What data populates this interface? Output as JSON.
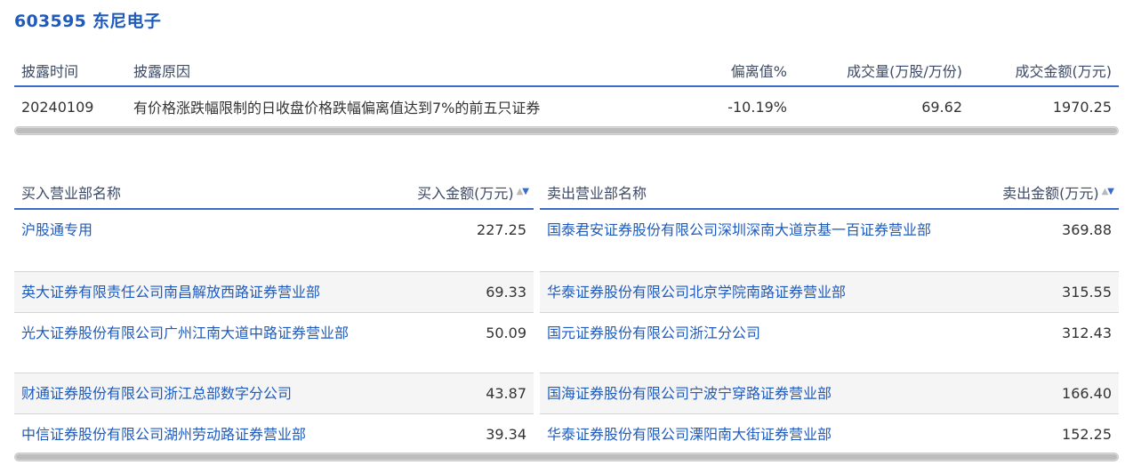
{
  "title": "603595 东尼电子",
  "disclosure": {
    "headers": {
      "date": "披露时间",
      "reason": "披露原因",
      "deviation": "偏离值%",
      "volume": "成交量(万股/万份)",
      "amount": "成交金额(万元)"
    },
    "rows": [
      {
        "date": "20240109",
        "reason": "有价格涨跌幅限制的日收盘价格跌幅偏离值达到7%的前五只证券",
        "deviation": "-10.19%",
        "volume": "69.62",
        "amount": "1970.25"
      }
    ]
  },
  "buy": {
    "header_name": "买入营业部名称",
    "header_amount": "买入金额(万元)",
    "sort_icon": "sort-desc-icon",
    "rows": [
      {
        "name": "沪股通专用",
        "amount": "227.25"
      },
      {
        "name": "英大证券有限责任公司南昌解放西路证券营业部",
        "amount": "69.33"
      },
      {
        "name": "光大证券股份有限公司广州江南大道中路证券营业部",
        "amount": "50.09"
      },
      {
        "name": "财通证券股份有限公司浙江总部数字分公司",
        "amount": "43.87"
      },
      {
        "name": "中信证券股份有限公司湖州劳动路证券营业部",
        "amount": "39.34"
      }
    ]
  },
  "sell": {
    "header_name": "卖出营业部名称",
    "header_amount": "卖出金额(万元)",
    "sort_icon": "sort-desc-icon",
    "rows": [
      {
        "name": "国泰君安证券股份有限公司深圳深南大道京基一百证券营业部",
        "amount": "369.88"
      },
      {
        "name": "华泰证券股份有限公司北京学院南路证券营业部",
        "amount": "315.55"
      },
      {
        "name": "国元证券股份有限公司浙江分公司",
        "amount": "312.43"
      },
      {
        "name": "国海证券股份有限公司宁波宁穿路证券营业部",
        "amount": "166.40"
      },
      {
        "name": "华泰证券股份有限公司溧阳南大街证券营业部",
        "amount": "152.25"
      }
    ]
  },
  "colors": {
    "accent": "#1f5bbd",
    "rule": "#3b6cc7",
    "row_alt": "#f5f5f5"
  }
}
